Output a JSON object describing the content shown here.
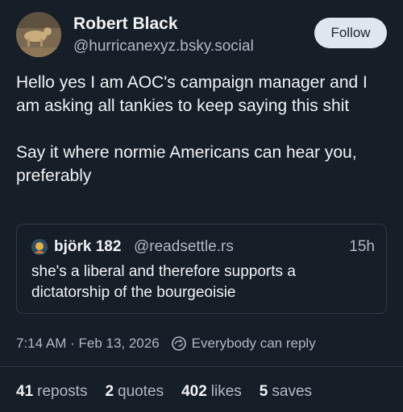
{
  "author": {
    "display_name": "Robert Black",
    "handle": "@hurricanexyz.bsky.social"
  },
  "follow_label": "Follow",
  "body": {
    "paragraph1": "Hello yes I am AOC's campaign manager and I am asking all tankies to keep saying this shit",
    "paragraph2": "Say it where normie Americans can hear you, preferably"
  },
  "quote": {
    "display_name": "björk 182",
    "handle": "@readsettle.rs",
    "time": "15h",
    "text": "she's a liberal and therefore supports a dictatorship of the bourgeoisie"
  },
  "meta": {
    "timestamp": "7:14 AM · Feb 13, 2026",
    "reply_setting": "Everybody can reply"
  },
  "stats": {
    "reposts_count": "41",
    "reposts_label": "reposts",
    "quotes_count": "2",
    "quotes_label": "quotes",
    "likes_count": "402",
    "likes_label": "likes",
    "saves_count": "5",
    "saves_label": "saves"
  },
  "colors": {
    "background": "#161e27",
    "text_primary": "#f1f3f5",
    "text_secondary": "#aebbc9",
    "follow_button_bg": "#dfe6ee",
    "border": "#2e3a48"
  }
}
